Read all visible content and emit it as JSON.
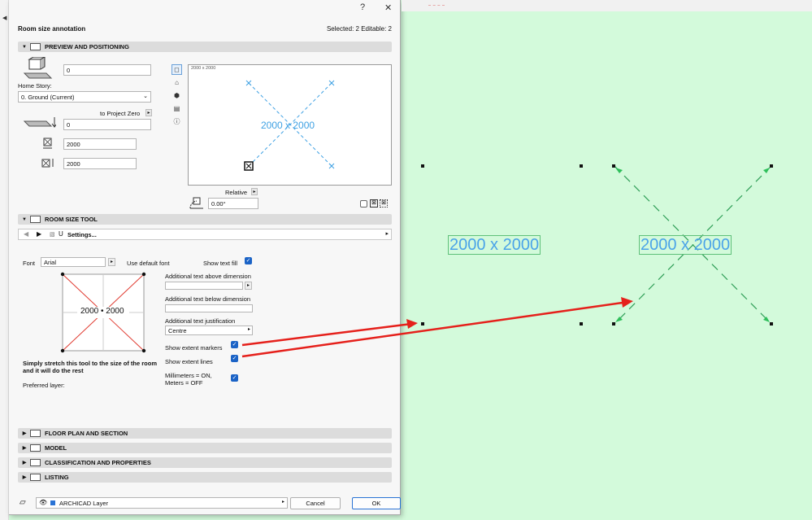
{
  "dialog": {
    "help_glyph": "?",
    "close_glyph": "✕",
    "title": "Room size annotation",
    "selection_info": "Selected: 2 Editable: 2"
  },
  "sections": {
    "preview": "PREVIEW AND POSITIONING",
    "room_tool": "ROOM SIZE TOOL",
    "floor_plan": "FLOOR PLAN AND SECTION",
    "model": "MODEL",
    "classification": "CLASSIFICATION AND PROPERTIES",
    "listing": "LISTING"
  },
  "positioning": {
    "elevation": "0",
    "home_story_label": "Home Story:",
    "home_story_value": "0. Ground (Current)",
    "to_project_zero": "to Project Zero",
    "offset": "0",
    "width": "2000",
    "depth": "2000",
    "relative_label": "Relative",
    "angle": "0.00°"
  },
  "preview_box": {
    "size_caption": "2000 x 2000",
    "label": "2000 x 2000"
  },
  "settings_bar": {
    "label": "Settings..."
  },
  "room_tool": {
    "font_label": "Font",
    "font_value": "Arial",
    "use_default_font": "Use default font",
    "show_text_fill": "Show text fill",
    "diagram_text": "2000 • 2000",
    "help_text": "Simply stretch this tool to the size of the room and it will do the rest",
    "preferred_layer": "Preferred layer:",
    "above_label": "Additional text above dimension",
    "below_label": "Additional text below dimension",
    "justification_label": "Additional text justification",
    "justification_value": "Centre",
    "show_extent_markers": "Show extent markers",
    "show_extent_lines": "Show extent lines",
    "millimeters": "Millimeters = ON,\nMeters = OFF"
  },
  "bottom": {
    "layer": "ARCHICAD Layer",
    "cancel": "Cancel",
    "ok": "OK"
  },
  "canvas": {
    "label_left": "2000 x 2000",
    "label_right": "2000 x 2000"
  },
  "colors": {
    "canvas_bg": "#d3fadb",
    "accent_blue": "#1b63c6",
    "arrow_red": "#e5201b",
    "text_blue": "#4aa3e8",
    "extent_green": "#2f9e57"
  }
}
